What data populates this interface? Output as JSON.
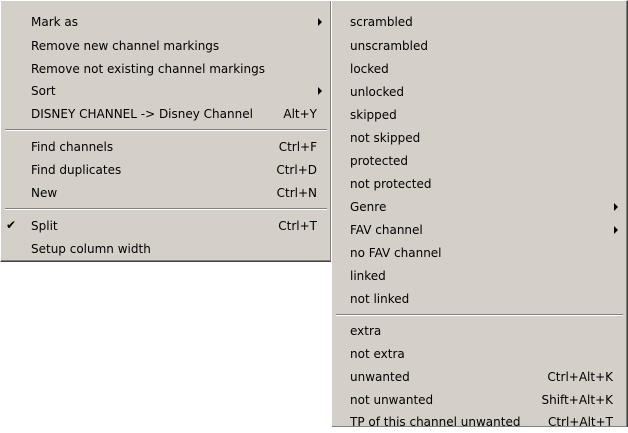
{
  "main_menu": {
    "items": [
      {
        "label": "Mark as",
        "shortcut": ""
      },
      {
        "label": "Remove new channel markings",
        "shortcut": ""
      },
      {
        "label": "Remove not existing channel markings",
        "shortcut": ""
      },
      {
        "label": "Sort",
        "shortcut": ""
      },
      {
        "label": "DISNEY CHANNEL -> Disney Channel",
        "shortcut": "Alt+Y"
      },
      {
        "label": "Find channels",
        "shortcut": "Ctrl+F"
      },
      {
        "label": "Find duplicates",
        "shortcut": "Ctrl+D"
      },
      {
        "label": "New",
        "shortcut": "Ctrl+N"
      },
      {
        "label": "Split",
        "shortcut": "Ctrl+T",
        "check": "✔"
      },
      {
        "label": "Setup column width",
        "shortcut": ""
      }
    ]
  },
  "submenu": {
    "items": [
      {
        "label": "scrambled",
        "shortcut": ""
      },
      {
        "label": "unscrambled",
        "shortcut": ""
      },
      {
        "label": "locked",
        "shortcut": ""
      },
      {
        "label": "unlocked",
        "shortcut": ""
      },
      {
        "label": "skipped",
        "shortcut": ""
      },
      {
        "label": "not skipped",
        "shortcut": ""
      },
      {
        "label": "protected",
        "shortcut": ""
      },
      {
        "label": "not protected",
        "shortcut": ""
      },
      {
        "label": "Genre",
        "shortcut": ""
      },
      {
        "label": "FAV channel",
        "shortcut": ""
      },
      {
        "label": "no FAV channel",
        "shortcut": ""
      },
      {
        "label": "linked",
        "shortcut": ""
      },
      {
        "label": "not linked",
        "shortcut": ""
      },
      {
        "label": "extra",
        "shortcut": ""
      },
      {
        "label": "not extra",
        "shortcut": ""
      },
      {
        "label": "unwanted",
        "shortcut": "Ctrl+Alt+K"
      },
      {
        "label": "not unwanted",
        "shortcut": "Shift+Alt+K"
      },
      {
        "label": "TP of this channel unwanted",
        "shortcut": "Ctrl+Alt+T"
      }
    ]
  },
  "icons": {
    "submenu_arrow": "triangle-right",
    "checkmark": "check"
  }
}
